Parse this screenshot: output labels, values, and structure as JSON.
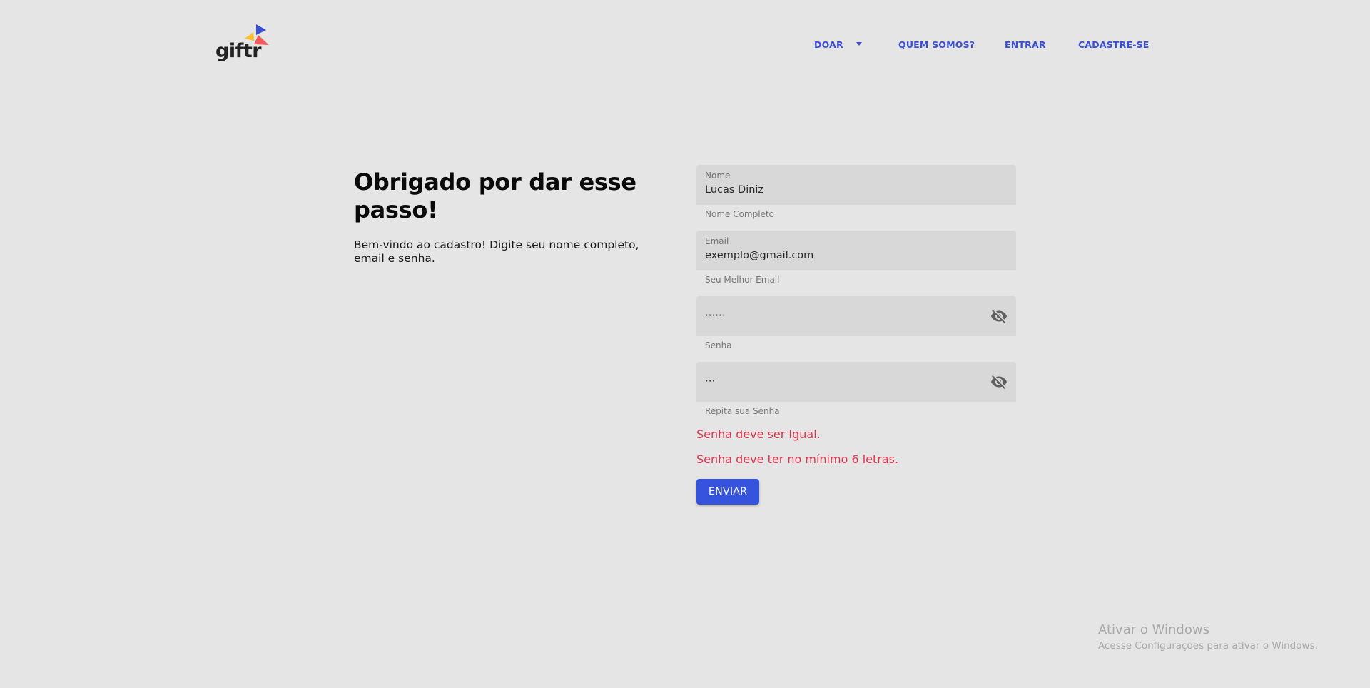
{
  "brand": {
    "name": "giftr",
    "colors": {
      "blue": "#3a4fd8",
      "yellow": "#f6c12c",
      "red": "#f05a5a"
    }
  },
  "nav": {
    "doar": "DOAR",
    "quem_somos": "QUEM SOMOS?",
    "entrar": "ENTRAR",
    "cadastre": "CADASTRE-SE"
  },
  "intro": {
    "title": "Obrigado por dar esse passo!",
    "text": "Bem-vindo ao cadastro! Digite seu nome completo, email e senha."
  },
  "form": {
    "name": {
      "label": "Nome",
      "value": "Lucas Diniz",
      "helper": "Nome Completo"
    },
    "email": {
      "label": "Email",
      "value": "exemplo@gmail.com",
      "helper": "Seu Melhor Email"
    },
    "password": {
      "value": "······",
      "helper": "Senha",
      "icon": "visibility-off-icon"
    },
    "password_repeat": {
      "value": "···",
      "helper": "Repita sua Senha",
      "icon": "visibility-off-icon"
    },
    "errors": [
      "Senha deve ser Igual.",
      "Senha deve ter no mínimo 6 letras."
    ],
    "submit_label": "ENVIAR"
  },
  "watermark": {
    "title": "Ativar o Windows",
    "subtitle": "Acesse Configurações para ativar o Windows."
  },
  "colors": {
    "background": "#e5e5e5",
    "field_bg": "#d8d8d8",
    "error": "#e0344e",
    "primary": "#3553dc"
  }
}
